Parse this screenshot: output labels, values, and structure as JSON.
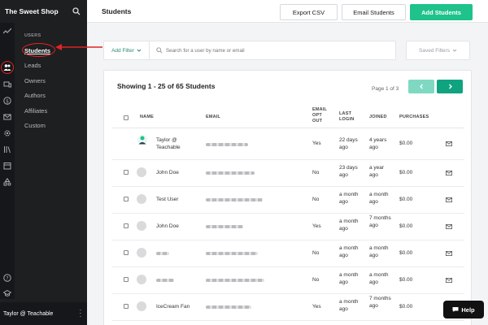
{
  "app": {
    "brand": "The Sweet Shop"
  },
  "sidebar": {
    "section_title": "USERS",
    "items": [
      {
        "label": "Students",
        "active": true
      },
      {
        "label": "Leads"
      },
      {
        "label": "Owners"
      },
      {
        "label": "Authors"
      },
      {
        "label": "Affiliates"
      },
      {
        "label": "Custom"
      }
    ],
    "user": "Taylor @ Teachable",
    "rail_icons": [
      "trend-icon",
      "users-icon",
      "devices-icon",
      "dollar-icon",
      "mail-icon",
      "gear-icon",
      "library-icon",
      "calendar-icon",
      "shapes-icon",
      "help-circle-icon",
      "graduation-icon"
    ]
  },
  "header": {
    "title": "Students",
    "export_label": "Export CSV",
    "email_label": "Email Students",
    "add_label": "Add Students"
  },
  "filter": {
    "add_filter_label": "Add Filter",
    "search_placeholder": "Search for a user by name or email",
    "saved_filters_label": "Saved Filters"
  },
  "table": {
    "showing": "Showing 1 - 25 of 65 Students",
    "page_of": "Page 1 of 3",
    "headers": {
      "name": "NAME",
      "email": "EMAIL",
      "email_opt_out": "EMAIL OPT OUT",
      "last_login": "LAST LOGIN",
      "joined": "JOINED",
      "purchases": "PURCHASES"
    },
    "rows": [
      {
        "name": "Taylor @ Teachable",
        "opt_out": "Yes",
        "last_login": "22 days ago",
        "joined": "4 years ago",
        "purchases": "$0.00"
      },
      {
        "name": "John Doe",
        "opt_out": "No",
        "last_login": "23 days ago",
        "joined": "a year ago",
        "purchases": "$0.00"
      },
      {
        "name": "Test User",
        "opt_out": "No",
        "last_login": "a month ago",
        "joined": "a month ago",
        "purchases": "$0.00"
      },
      {
        "name": "John Doe",
        "opt_out": "Yes",
        "last_login": "a month ago",
        "joined": "7 months ago",
        "purchases": "$0.00"
      },
      {
        "name": "",
        "opt_out": "No",
        "last_login": "a month ago",
        "joined": "a month ago",
        "purchases": "$0.00"
      },
      {
        "name": "",
        "opt_out": "No",
        "last_login": "a month ago",
        "joined": "a month ago",
        "purchases": "$0.00"
      },
      {
        "name": "IceCream Fan",
        "opt_out": "Yes",
        "last_login": "a month ago",
        "joined": "7 months ago",
        "purchases": "$0.00"
      }
    ]
  },
  "help_label": "Help",
  "colors": {
    "accent": "#1fc28b",
    "annotation": "#e02424",
    "sidebar": "#1e1f21"
  }
}
